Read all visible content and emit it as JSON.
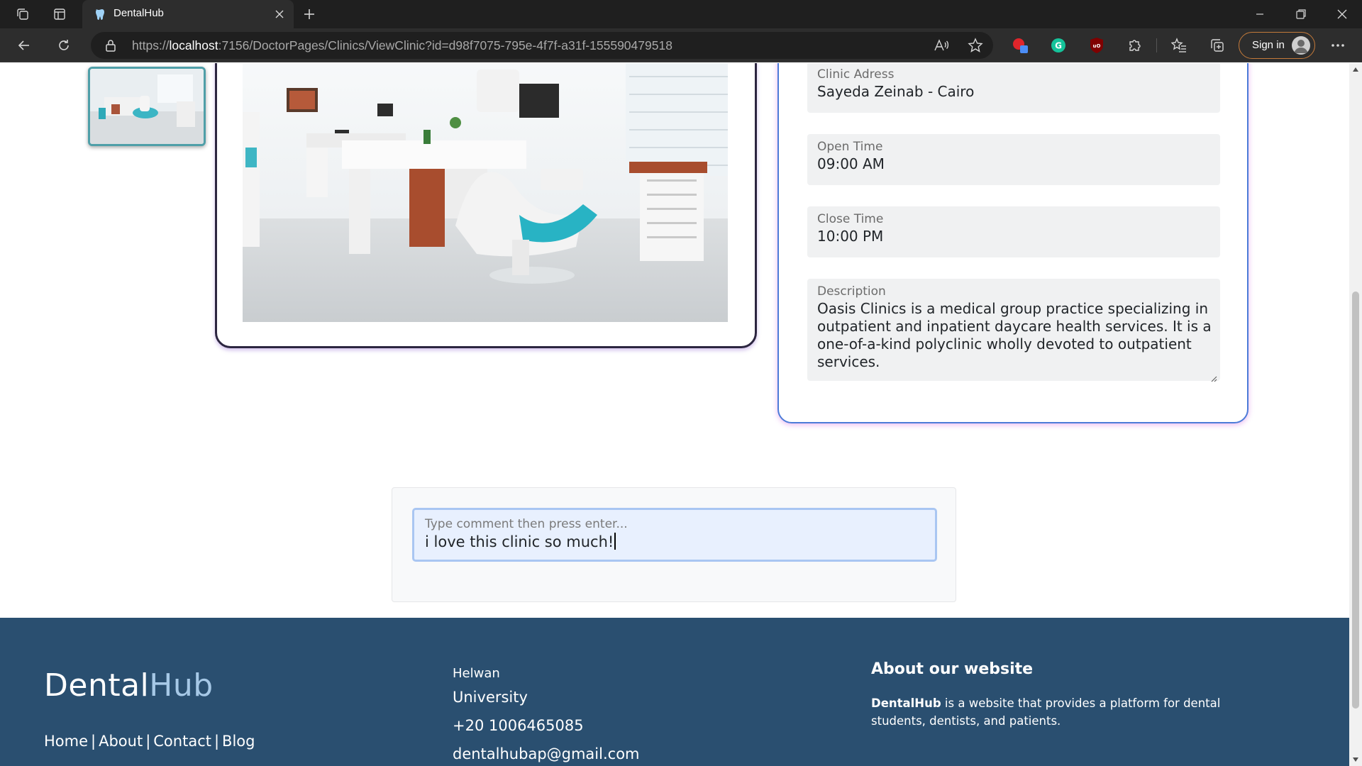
{
  "browser": {
    "tab_title": "DentalHub",
    "url_host": "localhost",
    "url_prefix": "https://",
    "url_rest": ":7156/DoctorPages/Clinics/ViewClinic?id=d98f7075-795e-4f7f-a31f-155590479518",
    "signin_label": "Sign in"
  },
  "clinic": {
    "address_label": "Clinic Adress",
    "address_value": "Sayeda Zeinab - Cairo",
    "open_label": "Open Time",
    "open_value": "09:00 AM",
    "close_label": "Close Time",
    "close_value": "10:00 PM",
    "description_label": "Description",
    "description_value": "Oasis Clinics is a medical group practice specializing in outpatient and inpatient daycare health services. It is a one-of-a-kind polyclinic wholly devoted to outpatient services."
  },
  "comment": {
    "placeholder": "Type comment then press enter...",
    "value": "i love this clinic so much!"
  },
  "footer": {
    "logo_part1": "Dental",
    "logo_part2": "Hub",
    "links": [
      "Home",
      "About",
      "Contact",
      "Blog"
    ],
    "separator": "|",
    "city": "Helwan",
    "university": "University",
    "phone": "+20 1006465085",
    "email": "dentalhubap@gmail.com",
    "about_title": "About our website",
    "about_brand": "DentalHub",
    "about_text": " is a website that provides a platform for dental students, dentists, and patients."
  }
}
